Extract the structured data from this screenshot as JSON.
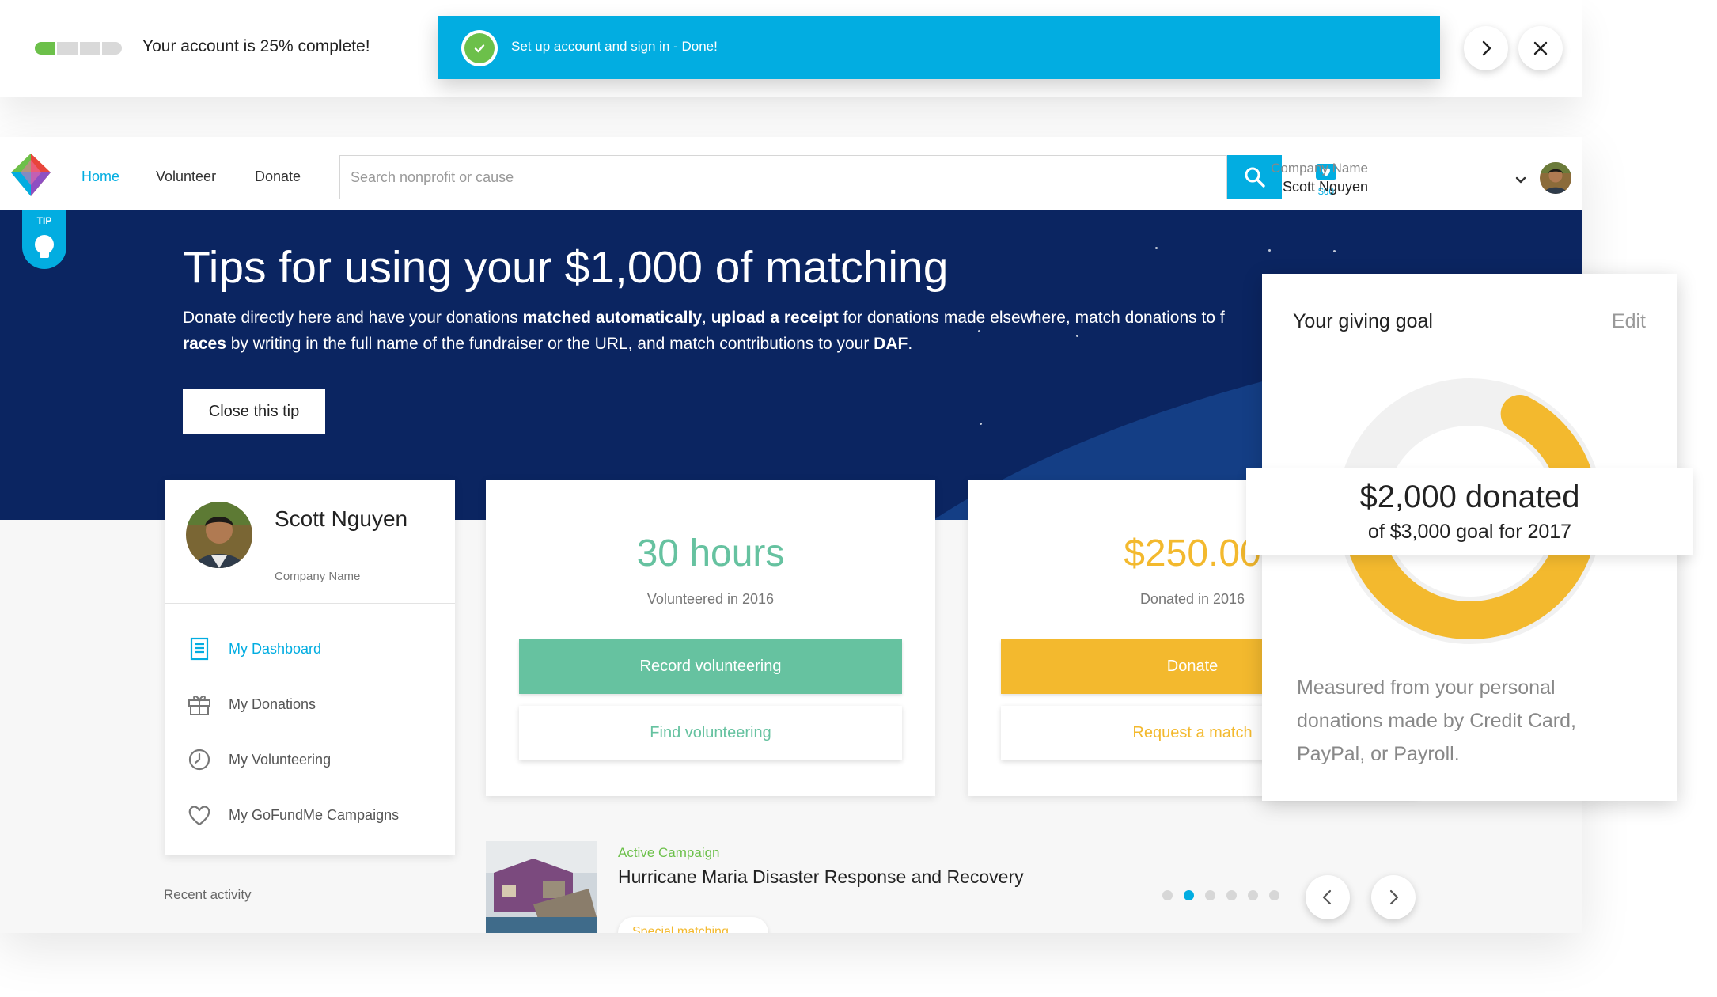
{
  "progress": {
    "percent": 25,
    "message": "Your account is 25% complete!",
    "toast": "Set up account and sign in - Done!"
  },
  "nav": {
    "links": [
      "Home",
      "Volunteer",
      "Donate"
    ],
    "search_placeholder": "Search nonprofit or cause",
    "wallet_amount": "$60",
    "company": "Company Name",
    "user": "Scott Nguyen"
  },
  "tip": {
    "badge": "TIP",
    "title": "Tips for using your $1,000 of matching",
    "body_parts": [
      "Donate directly here and have your donations ",
      "matched automatically",
      ", ",
      "upload a receipt",
      " for donations made elsewhere, match donations to f",
      "races",
      " by writing in the full name of the fundraiser or the URL, and match contributions to your ",
      "DAF",
      "."
    ],
    "close_label": "Close this tip"
  },
  "profile": {
    "name": "Scott Nguyen",
    "company": "Company Name",
    "menu": [
      {
        "label": "My Dashboard",
        "icon": "dashboard-icon",
        "active": true
      },
      {
        "label": "My Donations",
        "icon": "gift-icon",
        "active": false
      },
      {
        "label": "My Volunteering",
        "icon": "clock-icon",
        "active": false
      },
      {
        "label": "My GoFundMe Campaigns",
        "icon": "heart-icon",
        "active": false
      }
    ]
  },
  "volunteer": {
    "stat": "30 hours",
    "caption": "Volunteered in 2016",
    "primary": "Record volunteering",
    "secondary": "Find volunteering",
    "color": "#66c2a0"
  },
  "donations": {
    "stat": "$250.00",
    "caption": "Donated in 2016",
    "primary": "Donate",
    "secondary": "Request a match",
    "color": "#f3b92e"
  },
  "recent": {
    "label": "Recent activity"
  },
  "campaign": {
    "kicker": "Active Campaign",
    "title": "Hurricane Maria Disaster Response and Recovery",
    "pill": "Special matching",
    "dots": 6,
    "active_dot": 1
  },
  "goal": {
    "title": "Your giving goal",
    "edit": "Edit",
    "amount": "$2,000 donated",
    "of": "of $3,000 goal for 2017",
    "donated": 2000,
    "target": 3000,
    "note": "Measured from your personal donations made by Credit Card, PayPal, or Payroll."
  },
  "colors": {
    "accent": "#02ade1",
    "navy": "#0b2561",
    "green": "#6cc04a",
    "teal": "#66c2a0",
    "gold": "#f3b92e"
  }
}
